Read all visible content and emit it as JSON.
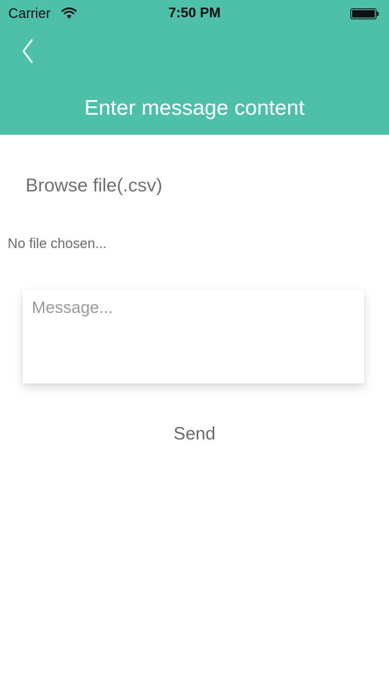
{
  "status_bar": {
    "carrier": "Carrier",
    "time": "7:50 PM",
    "wifi_icon": "wifi-icon",
    "battery_icon": "battery-full-icon"
  },
  "header": {
    "title": "Enter message content",
    "back_icon": "chevron-left-icon",
    "background_color": "#4ec0aa"
  },
  "form": {
    "browse_label": "Browse file(.csv)",
    "file_status": "No file chosen...",
    "message_placeholder": "Message...",
    "message_value": "",
    "send_label": "Send"
  }
}
